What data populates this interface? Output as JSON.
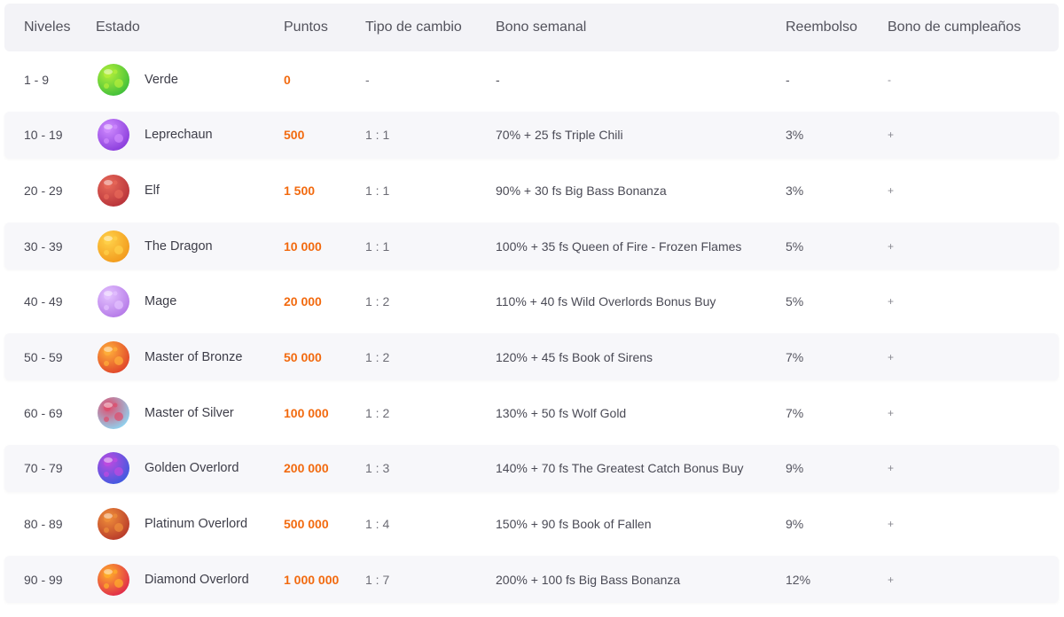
{
  "header": {
    "niveles": "Niveles",
    "estado": "Estado",
    "puntos": "Puntos",
    "tipo": "Tipo de cambio",
    "bono": "Bono semanal",
    "reembolso": "Reembolso",
    "cumple": "Bono de cumpleaños"
  },
  "rows": [
    {
      "niveles": "1 - 9",
      "estado": "Verde",
      "puntos": "0",
      "tipo": "-",
      "bono": "-",
      "reembolso": "-",
      "cumple": "-",
      "icon": "green-planet-icon",
      "color": "#3fbf3a",
      "accent": "#b6f03a"
    },
    {
      "niveles": "10 - 19",
      "estado": "Leprechaun",
      "puntos": "500",
      "tipo": "1 : 1",
      "bono": "70% + 25 fs Triple Chili",
      "reembolso": "3%",
      "cumple": "+",
      "icon": "purple-swirl-planet-icon",
      "color": "#8a3ddc",
      "accent": "#d08cff"
    },
    {
      "niveles": "20 - 29",
      "estado": "Elf",
      "puntos": "1 500",
      "tipo": "1 : 1",
      "bono": "90% + 30 fs Big Bass Bonanza",
      "reembolso": "3%",
      "cumple": "+",
      "icon": "red-rock-planet-icon",
      "color": "#b8333a",
      "accent": "#e86a5a"
    },
    {
      "niveles": "30 - 39",
      "estado": "The Dragon",
      "puntos": "10 000",
      "tipo": "1 : 1",
      "bono": "100% + 35 fs Queen of Fire - Frozen Flames",
      "reembolso": "5%",
      "cumple": "+",
      "icon": "orange-planet-icon",
      "color": "#f29a1c",
      "accent": "#ffd24a"
    },
    {
      "niveles": "40 - 49",
      "estado": "Mage",
      "puntos": "20 000",
      "tipo": "1 : 2",
      "bono": "110% + 40 fs Wild Overlords Bonus Buy",
      "reembolso": "5%",
      "cumple": "+",
      "icon": "lilac-planet-icon",
      "color": "#b57ae8",
      "accent": "#e4c2ff"
    },
    {
      "niveles": "50 - 59",
      "estado": "Master of Bronze",
      "puntos": "50 000",
      "tipo": "1 : 2",
      "bono": "120% + 45 fs Book of Sirens",
      "reembolso": "7%",
      "cumple": "+",
      "icon": "bronze-planet-icon",
      "color": "#e0442a",
      "accent": "#ffb13a"
    },
    {
      "niveles": "60 - 69",
      "estado": "Master of Silver",
      "puntos": "100 000",
      "tipo": "1 : 2",
      "bono": "130% + 50 fs Wolf Gold",
      "reembolso": "7%",
      "cumple": "+",
      "icon": "silver-planet-icon",
      "color": "#8fd3f0",
      "accent": "#e04a6a"
    },
    {
      "niveles": "70 - 79",
      "estado": "Golden Overlord",
      "puntos": "200 000",
      "tipo": "1 : 3",
      "bono": "140% + 70 fs The Greatest Catch Bonus Buy",
      "reembolso": "9%",
      "cumple": "+",
      "icon": "blue-purple-planet-icon",
      "color": "#3f5ae0",
      "accent": "#c04ae0"
    },
    {
      "niveles": "80 - 89",
      "estado": "Platinum Overlord",
      "puntos": "500 000",
      "tipo": "1 : 4",
      "bono": "150% + 90 fs Book of Fallen",
      "reembolso": "9%",
      "cumple": "+",
      "icon": "copper-planet-icon",
      "color": "#b83a2a",
      "accent": "#f0903a"
    },
    {
      "niveles": "90 - 99",
      "estado": "Diamond Overlord",
      "puntos": "1 000 000",
      "tipo": "1 : 7",
      "bono": "200% + 100 fs Big Bass Bonanza",
      "reembolso": "12%",
      "cumple": "+",
      "icon": "crimson-planet-icon",
      "color": "#e02a4a",
      "accent": "#ffb02a"
    }
  ]
}
